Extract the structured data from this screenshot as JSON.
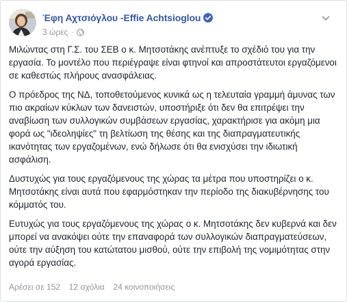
{
  "post": {
    "author": "Έφη Αχτσιόγλου -Effie Achtsioglou",
    "timestamp": "3 ώρες",
    "separator": "·",
    "privacy_icon": "globe-icon",
    "verified_icon": "verified-badge-icon",
    "paragraphs": [
      "Μιλώντας στη Γ.Σ. του ΣΕΒ ο κ. Μητσοτάκης ανέπτυξε το σχέδιό του για την εργασία. Το μοντέλο που περιέγραψε είναι φτηνοί και απροστάτευτοι εργαζόμενοι σε καθεστώς πλήρους ανασφάλειας.",
      "Ο πρόεδρος της ΝΔ, τοποθετούμενος κυνικά ως η τελευταία γραμμή άμυνας των πιο ακραίων κύκλων των δανειστών, υποστήριξε ότι δεν θα επιτρέψει την αναβίωση των συλλογικών συμβάσεων εργασίας, χαρακτήρισε για ακόμη μια φορά ως \"ιδεοληψίες\" τη βελτίωση της θέσης και της διαπραγματευτικής ικανότητας των εργαζομένων, ενώ δήλωσε ότι θα ενισχύσει την ιδιωτική ασφάλιση.",
      "Δυστυχώς για τους εργαζόμενους της χώρας τα μέτρα που υποστηρίζει ο κ. Μητσοτάκης είναι αυτά που εφαρμόστηκαν την περίοδο της διακυβέρνησης του κόμματός του.",
      "Ευτυχώς για τους εργαζόμενους της χώρας ο κ. Μητσοτάκης δεν κυβερνά και δεν μπορεί να ανακόψει ούτε την επαναφορά των συλλογικών διαπραγματεύσεων, ούτε την αύξηση του κατώτατου μισθού, ούτε την επιβολή της νομιμότητας στην αγορά εργασίας."
    ]
  },
  "footer": {
    "likes": "Αρέσει σε 152",
    "comments": "12 σχόλια",
    "shares": "24 κοινοποιήσεις"
  },
  "colors": {
    "author_link": "#365899",
    "verified": "#4267b2",
    "meta": "#90949c",
    "text": "#1d2129",
    "border": "#dddfe2"
  }
}
